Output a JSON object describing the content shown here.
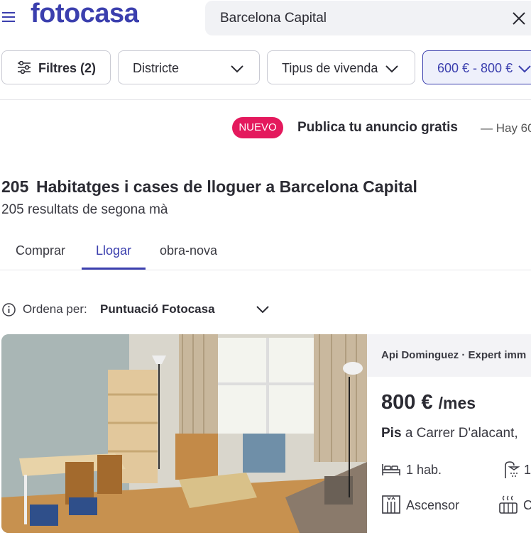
{
  "header": {
    "logo": "fotocasa",
    "search_value": "Barcelona Capital"
  },
  "filters": {
    "filters_label": "Filtres (2)",
    "district_label": "Districte",
    "type_label": "Tipus de vivenda",
    "price_label": "600 € - 800 €"
  },
  "promo": {
    "badge": "NUEVO",
    "title": "Publica tu anuncio gratis",
    "subtitle": "— Hay 60"
  },
  "results": {
    "count": "205",
    "title": "Habitatges i cases de lloguer a Barcelona Capital",
    "subtitle": "205 resultats de segona mà"
  },
  "tabs": [
    {
      "label": "Comprar",
      "active": false
    },
    {
      "label": "Llogar",
      "active": true
    },
    {
      "label": "obra-nova",
      "active": false
    }
  ],
  "sort": {
    "label": "Ordena per:",
    "value": "Puntuació Fotocasa"
  },
  "listing": {
    "agency": "Api Dominguez · Expert imm",
    "price": "800 €",
    "price_unit": "/mes",
    "type": "Pis",
    "address": "a Carrer D'alacant, ",
    "rooms": "1 hab.",
    "baths": "1",
    "elevator": "Ascensor",
    "heating": "C"
  },
  "colors": {
    "brand": "#3b3fae",
    "badge": "#e4195d"
  }
}
